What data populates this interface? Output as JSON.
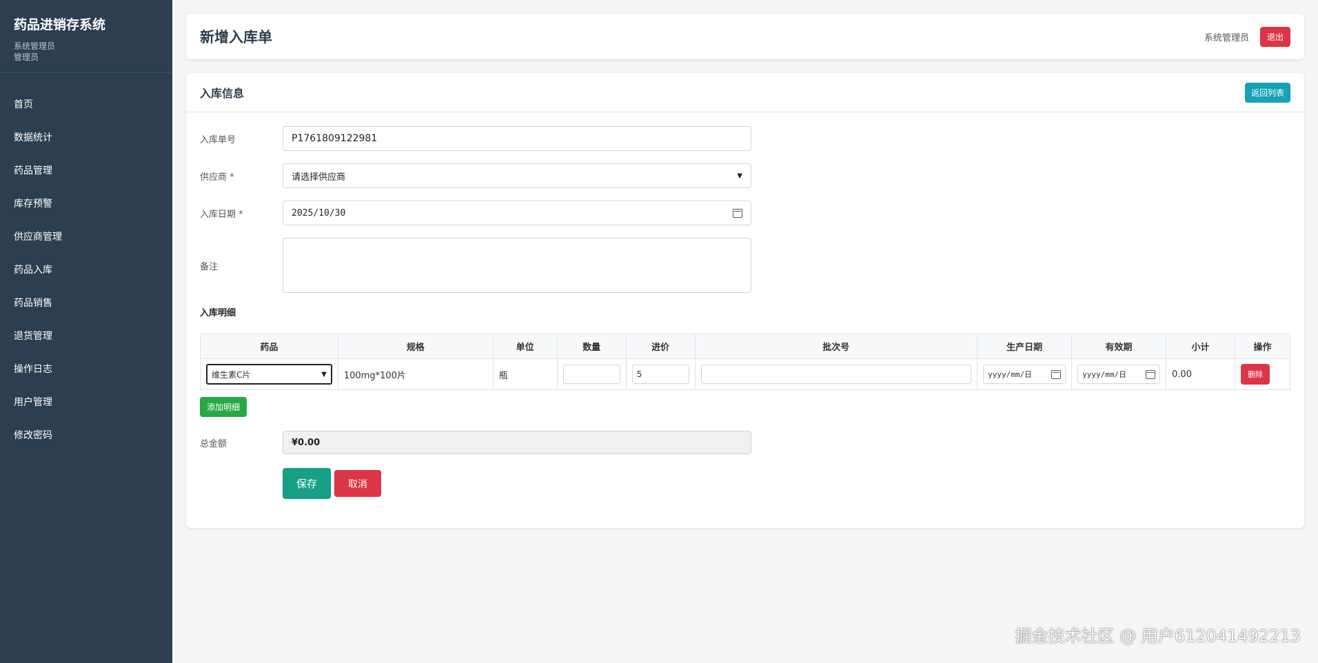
{
  "sidebar": {
    "brand_title": "药品进销存系统",
    "role_line1": "系统管理员",
    "role_line2": "管理员",
    "items": [
      {
        "label": "首页"
      },
      {
        "label": "数据统计"
      },
      {
        "label": "药品管理"
      },
      {
        "label": "库存预警"
      },
      {
        "label": "供应商管理"
      },
      {
        "label": "药品入库"
      },
      {
        "label": "药品销售"
      },
      {
        "label": "退货管理"
      },
      {
        "label": "操作日志"
      },
      {
        "label": "用户管理"
      },
      {
        "label": "修改密码"
      }
    ]
  },
  "header": {
    "title": "新增入库单",
    "user_name": "系统管理员",
    "logout_label": "退出"
  },
  "card": {
    "title": "入库信息",
    "back_label": "返回列表"
  },
  "form": {
    "order_no_label": "入库单号",
    "order_no_value": "P1761809122981",
    "supplier_label": "供应商 *",
    "supplier_value": "请选择供应商",
    "date_label": "入库日期 *",
    "date_value": "2025/10/30",
    "remark_label": "备注",
    "remark_value": ""
  },
  "details": {
    "section_title": "入库明细",
    "columns": [
      "药品",
      "规格",
      "单位",
      "数量",
      "进价",
      "批次号",
      "生产日期",
      "有效期",
      "小计",
      "操作"
    ],
    "rows": [
      {
        "drug": "维生素C片",
        "spec": "100mg*100片",
        "unit": "瓶",
        "quantity": "",
        "price": "5",
        "batch": "",
        "production_date": "yyyy/mm/日",
        "expiry_date": "yyyy/mm/日",
        "subtotal": "0.00",
        "delete_label": "删除"
      }
    ],
    "add_label": "添加明细"
  },
  "total": {
    "label": "总金额",
    "value": "¥0.00"
  },
  "actions": {
    "save_label": "保存",
    "cancel_label": "取消"
  },
  "watermark": "掘金技术社区 @ 用户612041492213"
}
